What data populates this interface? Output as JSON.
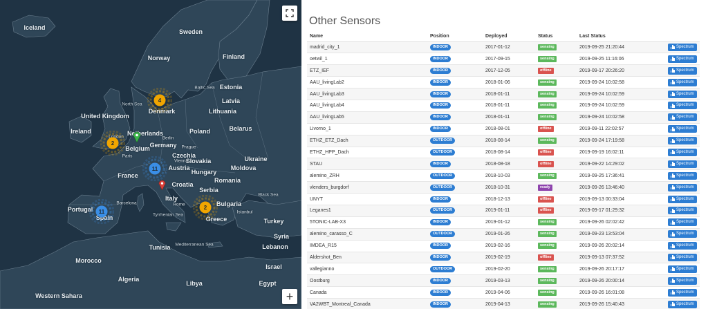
{
  "map": {
    "fullscreen_icon": "fullscreen-icon",
    "zoom_in_label": "+",
    "countries": [
      {
        "id": "iceland",
        "label": "Iceland"
      },
      {
        "id": "sweden",
        "label": "Sweden"
      },
      {
        "id": "norway",
        "label": "Norway"
      },
      {
        "id": "finland",
        "label": "Finland"
      },
      {
        "id": "estonia",
        "label": "Estonia"
      },
      {
        "id": "latvia",
        "label": "Latvia"
      },
      {
        "id": "lithuania",
        "label": "Lithuania"
      },
      {
        "id": "denmark",
        "label": "Denmark"
      },
      {
        "id": "uk",
        "label": "United Kingdom"
      },
      {
        "id": "ireland",
        "label": "Ireland"
      },
      {
        "id": "netherlands",
        "label": "Netherlands"
      },
      {
        "id": "belgium",
        "label": "Belgium"
      },
      {
        "id": "germany",
        "label": "Germany"
      },
      {
        "id": "poland",
        "label": "Poland"
      },
      {
        "id": "belarus",
        "label": "Belarus"
      },
      {
        "id": "ukraine",
        "label": "Ukraine"
      },
      {
        "id": "czechia",
        "label": "Czechia"
      },
      {
        "id": "slovakia",
        "label": "Slovakia"
      },
      {
        "id": "austria",
        "label": "Austria"
      },
      {
        "id": "hungary",
        "label": "Hungary"
      },
      {
        "id": "moldova",
        "label": "Moldova"
      },
      {
        "id": "france",
        "label": "France"
      },
      {
        "id": "romania",
        "label": "Romania"
      },
      {
        "id": "croatia",
        "label": "Croatia"
      },
      {
        "id": "serbia",
        "label": "Serbia"
      },
      {
        "id": "italy",
        "label": "Italy"
      },
      {
        "id": "bulgaria",
        "label": "Bulgaria"
      },
      {
        "id": "portugal",
        "label": "Portugal"
      },
      {
        "id": "spain",
        "label": "Spain"
      },
      {
        "id": "greece",
        "label": "Greece"
      },
      {
        "id": "turkey",
        "label": "Turkey"
      },
      {
        "id": "tunisia",
        "label": "Tunisia"
      },
      {
        "id": "morocco",
        "label": "Morocco"
      },
      {
        "id": "algeria",
        "label": "Algeria"
      },
      {
        "id": "libya",
        "label": "Libya"
      },
      {
        "id": "egypt",
        "label": "Egypt"
      },
      {
        "id": "western-sahara",
        "label": "Western Sahara"
      },
      {
        "id": "syria",
        "label": "Syria"
      },
      {
        "id": "lebanon",
        "label": "Lebanon"
      },
      {
        "id": "israel",
        "label": "Israel"
      }
    ],
    "cities": [
      {
        "id": "london",
        "label": "London"
      },
      {
        "id": "paris",
        "label": "Paris"
      },
      {
        "id": "berlin",
        "label": "Berlin"
      },
      {
        "id": "prague",
        "label": "Prague"
      },
      {
        "id": "vienna",
        "label": "Vienna"
      },
      {
        "id": "barcelona",
        "label": "Barcelona"
      },
      {
        "id": "rome",
        "label": "Rome"
      },
      {
        "id": "istanbul",
        "label": "Istanbul"
      }
    ],
    "seas": [
      {
        "id": "north-sea",
        "label": "North Sea"
      },
      {
        "id": "baltic-sea",
        "label": "Baltic Sea"
      },
      {
        "id": "black-sea",
        "label": "Black Sea"
      },
      {
        "id": "tyrrhenian-sea",
        "label": "Tyrrhenian Sea"
      },
      {
        "id": "mediterranean-sea",
        "label": "Mediterranean Sea"
      }
    ],
    "clusters": [
      {
        "id": "denmark",
        "count": "4",
        "color": "#f0a500"
      },
      {
        "id": "london",
        "count": "2",
        "color": "#f0a500"
      },
      {
        "id": "switzerland",
        "count": "11",
        "color": "#3a8ee6"
      },
      {
        "id": "spain",
        "count": "11",
        "color": "#3a8ee6"
      },
      {
        "id": "greece",
        "count": "2",
        "color": "#f0a500"
      }
    ],
    "markers": [
      {
        "id": "green-marker",
        "color": "#3bb54a"
      },
      {
        "id": "red-marker",
        "color": "#d9403a"
      }
    ]
  },
  "panel": {
    "title": "Other Sensors",
    "columns": [
      "Name",
      "Position",
      "Deployed",
      "Status",
      "Last Status",
      ""
    ],
    "spectrum_label": "Spectrum",
    "colors": {
      "indoor": "#2d7dd2",
      "sensing": "#5cb85c",
      "offline": "#d9534f",
      "ready": "#8e44ad"
    },
    "rows": [
      {
        "name": "madrid_city_1",
        "position": "INDOOR",
        "deployed": "2017-01-12",
        "status": "sensing",
        "last": "2019-09-25 21:20:44"
      },
      {
        "name": "oetwil_1",
        "position": "INDOOR",
        "deployed": "2017-09-15",
        "status": "sensing",
        "last": "2019-09-25 11:16:06"
      },
      {
        "name": "ETZ_IEF",
        "position": "INDOOR",
        "deployed": "2017-12-05",
        "status": "offline",
        "last": "2019-09-17 20:26:20"
      },
      {
        "name": "AAU_livingLab2",
        "position": "INDOOR",
        "deployed": "2018-01-06",
        "status": "sensing",
        "last": "2019-09-24 10:02:58"
      },
      {
        "name": "AAU_livingLab3",
        "position": "INDOOR",
        "deployed": "2018-01-11",
        "status": "sensing",
        "last": "2019-09-24 10:02:59"
      },
      {
        "name": "AAU_livingLab4",
        "position": "INDOOR",
        "deployed": "2018-01-11",
        "status": "sensing",
        "last": "2019-09-24 10:02:59"
      },
      {
        "name": "AAU_livingLab5",
        "position": "INDOOR",
        "deployed": "2018-01-11",
        "status": "sensing",
        "last": "2019-09-24 10:02:58"
      },
      {
        "name": "Livorno_1",
        "position": "INDOOR",
        "deployed": "2018-08-01",
        "status": "offline",
        "last": "2019-09-11 22:02:57"
      },
      {
        "name": "ETHZ_ETZ_Dach",
        "position": "OUTDOOR",
        "deployed": "2018-08-14",
        "status": "sensing",
        "last": "2019-09-24 17:19:58"
      },
      {
        "name": "ETHZ_HPP_Dach",
        "position": "OUTDOOR",
        "deployed": "2018-08-14",
        "status": "offline",
        "last": "2019-09-19 16:02:11"
      },
      {
        "name": "STAU",
        "position": "INDOOR",
        "deployed": "2018-08-18",
        "status": "offline",
        "last": "2019-09-22 14:29:02"
      },
      {
        "name": "alemino_ZRH",
        "position": "OUTDOOR",
        "deployed": "2018-10-03",
        "status": "sensing",
        "last": "2019-09-25 17:36:41"
      },
      {
        "name": "vlenders_burgdorf",
        "position": "OUTDOOR",
        "deployed": "2018-10-31",
        "status": "ready",
        "last": "2019-09-26 13:46:40"
      },
      {
        "name": "UNYT",
        "position": "INDOOR",
        "deployed": "2018-12-13",
        "status": "offline",
        "last": "2019-09-13 00:33:04"
      },
      {
        "name": "Leganes1",
        "position": "OUTDOOR",
        "deployed": "2019-01-11",
        "status": "offline",
        "last": "2019-09-17 01:29:32"
      },
      {
        "name": "5TONIC-LAB-X3",
        "position": "INDOOR",
        "deployed": "2019-01-12",
        "status": "sensing",
        "last": "2019-09-26 02:02:42"
      },
      {
        "name": "alemino_carasso_C",
        "position": "OUTDOOR",
        "deployed": "2019-01-26",
        "status": "sensing",
        "last": "2019-09-23 13:53:04"
      },
      {
        "name": "IMDEA_R15",
        "position": "INDOOR",
        "deployed": "2019-02-16",
        "status": "sensing",
        "last": "2019-09-26 20:02:14"
      },
      {
        "name": "Aldershot_Ben",
        "position": "INDOOR",
        "deployed": "2019-02-19",
        "status": "offline",
        "last": "2019-09-13 07:37:52"
      },
      {
        "name": "vallegianno",
        "position": "OUTDOOR",
        "deployed": "2019-02-20",
        "status": "sensing",
        "last": "2019-09-26 20:17:17"
      },
      {
        "name": "Oostburg",
        "position": "INDOOR",
        "deployed": "2019-03-13",
        "status": "sensing",
        "last": "2019-09-26 20:00:14"
      },
      {
        "name": "Canada",
        "position": "INDOOR",
        "deployed": "2019-04-06",
        "status": "sensing",
        "last": "2019-09-26 16:01:08"
      },
      {
        "name": "VA2WBT_Montreal_Canada",
        "position": "INDOOR",
        "deployed": "2019-04-13",
        "status": "sensing",
        "last": "2019-09-26 15:40:43"
      }
    ]
  }
}
